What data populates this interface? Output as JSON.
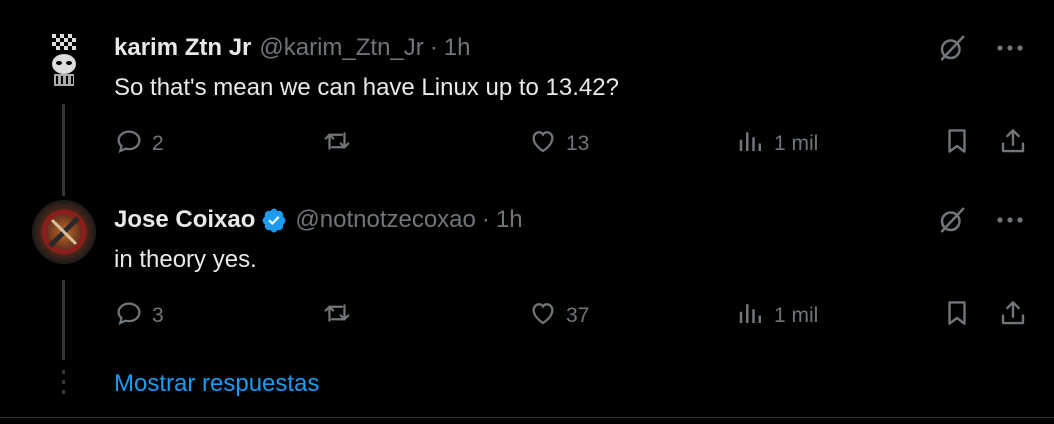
{
  "tweets": [
    {
      "name": "karim Ztn Jr",
      "handle": "@karim_Ztn_Jr",
      "separator": "·",
      "time": "1h",
      "verified": false,
      "text": "So that's mean we can have Linux up to 13.42?",
      "replies": "2",
      "retweets": "",
      "likes": "13",
      "views": "1 mil"
    },
    {
      "name": "Jose Coixao",
      "handle": "@notnotzecoxao",
      "separator": "·",
      "time": "1h",
      "verified": true,
      "text": "in theory yes.",
      "replies": "3",
      "retweets": "",
      "likes": "37",
      "views": "1 mil"
    }
  ],
  "show_replies": "Mostrar respuestas",
  "colors": {
    "background": "#000000",
    "text_primary": "#e7e9ea",
    "text_secondary": "#71767b",
    "accent": "#1d9bf0",
    "line": "#333639"
  },
  "icons": [
    "grok-icon",
    "more-icon",
    "reply-icon",
    "retweet-icon",
    "like-icon",
    "views-icon",
    "bookmark-icon",
    "share-icon",
    "verified-icon"
  ]
}
